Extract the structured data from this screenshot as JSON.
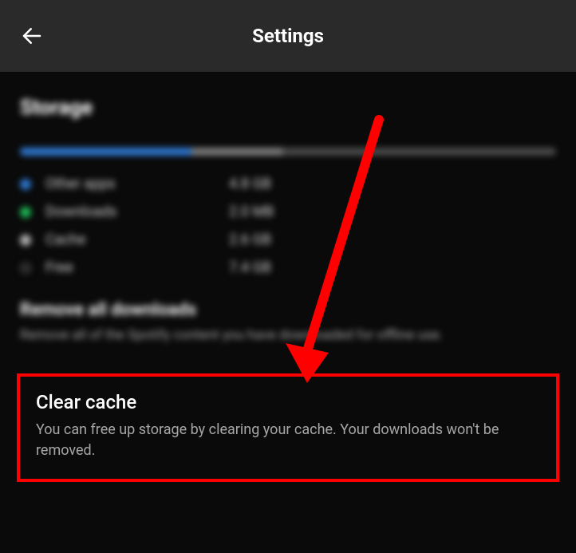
{
  "header": {
    "title": "Settings"
  },
  "storage": {
    "heading": "Storage",
    "bar": {
      "blue_percent": 32,
      "gray_percent": 17,
      "free_percent": 51
    },
    "legend": [
      {
        "dot_color": "#2e77d0",
        "label": "Other apps",
        "value": "4.8 GB"
      },
      {
        "dot_color": "#1db954",
        "label": "Downloads",
        "value": "2.0 MB"
      },
      {
        "dot_color": "#b3b3b3",
        "label": "Cache",
        "value": "2.6 GB"
      },
      {
        "dot_color": "#2a2a2a",
        "label": "Free",
        "value": "7.4 GB"
      }
    ]
  },
  "remove_downloads": {
    "title": "Remove all downloads",
    "desc": "Remove all of the Spotify content you have downloaded for offline use."
  },
  "clear_cache": {
    "title": "Clear cache",
    "desc": "You can free up storage by clearing your cache. Your downloads won't be removed."
  },
  "annotation": {
    "color": "#ff0000"
  }
}
